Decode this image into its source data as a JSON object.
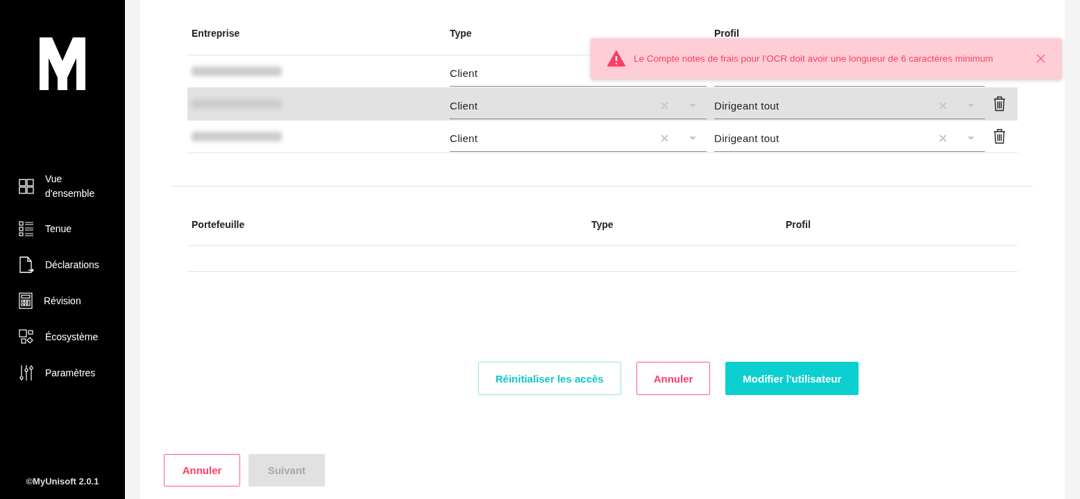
{
  "sidebar": {
    "items": [
      {
        "label": "Vue d'ensemble",
        "selected": false
      },
      {
        "label": "Tenue",
        "selected": false
      },
      {
        "label": "Déclarations",
        "selected": false
      },
      {
        "label": "Révision",
        "selected": false
      },
      {
        "label": "Écosystème",
        "selected": false
      },
      {
        "label": "Paramètres",
        "selected": false
      }
    ],
    "footer": "©MyUnisoft 2.0.1"
  },
  "companies": {
    "columns": [
      "Entreprise",
      "Type",
      "Profil"
    ],
    "rows": [
      {
        "selected": false,
        "type": "Client"
      },
      {
        "selected": true,
        "type": "Client",
        "profile": "Dirigeant tout"
      },
      {
        "selected": false,
        "type": "Client",
        "profile": "Dirigeant tout"
      }
    ]
  },
  "portfolios": {
    "columns": [
      "Portefeuille",
      "Type",
      "Profil"
    ]
  },
  "actions": [
    {
      "label": "Réinitialiser les accès",
      "kind": "outline-teal"
    },
    {
      "label": "Annuler",
      "kind": "outline-red"
    },
    {
      "label": "Modifier l'utilisateur",
      "kind": "primary"
    }
  ],
  "footer_buttons": [
    {
      "label": "Annuler",
      "disabled": false
    },
    {
      "label": "Suivant",
      "disabled": true
    }
  ],
  "toast": {
    "message": "Le Compte notes de frais pour l’OCR doit avoir une longueur de 6 caractères minimum"
  }
}
